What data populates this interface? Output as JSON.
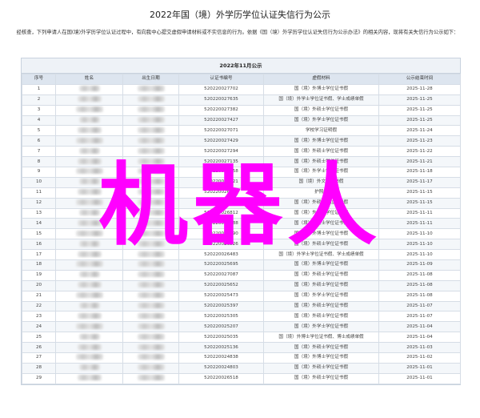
{
  "title": "2022年国（境）外学历学位认证失信行为公示",
  "intro": "经核查，下列申请人在国(境)外学历学位认证过程中，有向我中心提交虚假申请材料或不实信息的行为。依据《国（境）外学历学位认证失信行为公示办法》的相关内容，现将有关失信行为公示如下：",
  "table": {
    "caption": "2022年11月公示",
    "headers": [
      "序号",
      "姓名",
      "出生日期",
      "认证书编号",
      "虚假材料",
      "公示结束时间"
    ],
    "rows": [
      {
        "no": "1",
        "cert": "520220027702",
        "material": "国（境）外博士学位证书假",
        "end": "2025-11-28"
      },
      {
        "no": "2",
        "cert": "520220027635",
        "material": "国（境）外学士学位证书假、学士成绩单假",
        "end": "2025-11-25"
      },
      {
        "no": "3",
        "cert": "520220027382",
        "material": "国（境）外硕士学位证书假",
        "end": "2025-11-25"
      },
      {
        "no": "4",
        "cert": "520220027427",
        "material": "国（境）外学士学位证书假",
        "end": "2025-11-25"
      },
      {
        "no": "5",
        "cert": "520220027071",
        "material": "学校学习证明假",
        "end": "2025-11-24"
      },
      {
        "no": "6",
        "cert": "520220027429",
        "material": "国（境）外博士学位证书假",
        "end": "2025-11-23"
      },
      {
        "no": "7",
        "cert": "520220027294",
        "material": "国（境）外硕士学位证书假",
        "end": "2025-11-22"
      },
      {
        "no": "8",
        "cert": "520220027135",
        "material": "国（境）外硕士学位证书假",
        "end": "2025-11-21"
      },
      {
        "no": "9",
        "cert": "520220027158",
        "material": "国（境）外学士学位证书假",
        "end": "2025-11-18"
      },
      {
        "no": "10",
        "cert": "520220026821",
        "material": "国（境）外文凭证书假",
        "end": "2025-11-17"
      },
      {
        "no": "11",
        "cert": "520220026779",
        "material": "护照假",
        "end": "2025-11-15"
      },
      {
        "no": "12",
        "cert": "520220026640",
        "material": "国（境）外硕士学位证书假",
        "end": "2025-11-15"
      },
      {
        "no": "13",
        "cert": "520220026812",
        "material": "国（境）外博士学位证书假",
        "end": "2025-11-11"
      },
      {
        "no": "14",
        "cert": "520220026688",
        "material": "国（境）外硕士学位证书假",
        "end": "2025-11-11"
      },
      {
        "no": "15",
        "cert": "520220026490",
        "material": "国（境）外博士学位证书假",
        "end": "2025-11-10"
      },
      {
        "no": "16",
        "cert": "520220026526",
        "material": "国（境）外硕士学位证书假",
        "end": "2025-11-10"
      },
      {
        "no": "17",
        "cert": "520220026483",
        "material": "国（境）外学士学位证书假、学士成绩单假",
        "end": "2025-11-10"
      },
      {
        "no": "18",
        "cert": "520220025695",
        "material": "国（境）外博士学位证书假",
        "end": "2025-11-09"
      },
      {
        "no": "19",
        "cert": "520220027087",
        "material": "国（境）外硕士学位证书假",
        "end": "2025-11-08"
      },
      {
        "no": "20",
        "cert": "520220025652",
        "material": "国（境）外硕士学位证书假",
        "end": "2025-11-08"
      },
      {
        "no": "21",
        "cert": "520220025473",
        "material": "国（境）外学士学位证书假",
        "end": "2025-11-08"
      },
      {
        "no": "22",
        "cert": "520220025397",
        "material": "国（境）外硕士学位证书假",
        "end": "2025-11-07"
      },
      {
        "no": "23",
        "cert": "520220025305",
        "material": "国（境）外硕士学位证书假",
        "end": "2025-11-07"
      },
      {
        "no": "24",
        "cert": "520220025207",
        "material": "国（境）外学士学位证书假",
        "end": "2025-11-04"
      },
      {
        "no": "25",
        "cert": "520220025035",
        "material": "国（境）外博士学位证书假、博士成绩单假",
        "end": "2025-11-04"
      },
      {
        "no": "26",
        "cert": "520220025136",
        "material": "国（境）外硕士学位证书假",
        "end": "2025-11-03"
      },
      {
        "no": "27",
        "cert": "520220024838",
        "material": "国（境）外博士学位证书假",
        "end": "2025-11-02"
      },
      {
        "no": "28",
        "cert": "520220024803",
        "material": "国（境）外硕士学位证书假",
        "end": "2025-11-01"
      },
      {
        "no": "29",
        "cert": "520220026518",
        "material": "国（境）外硕士学位证书假",
        "end": "2025-11-01"
      }
    ]
  },
  "watermark": "机器人"
}
